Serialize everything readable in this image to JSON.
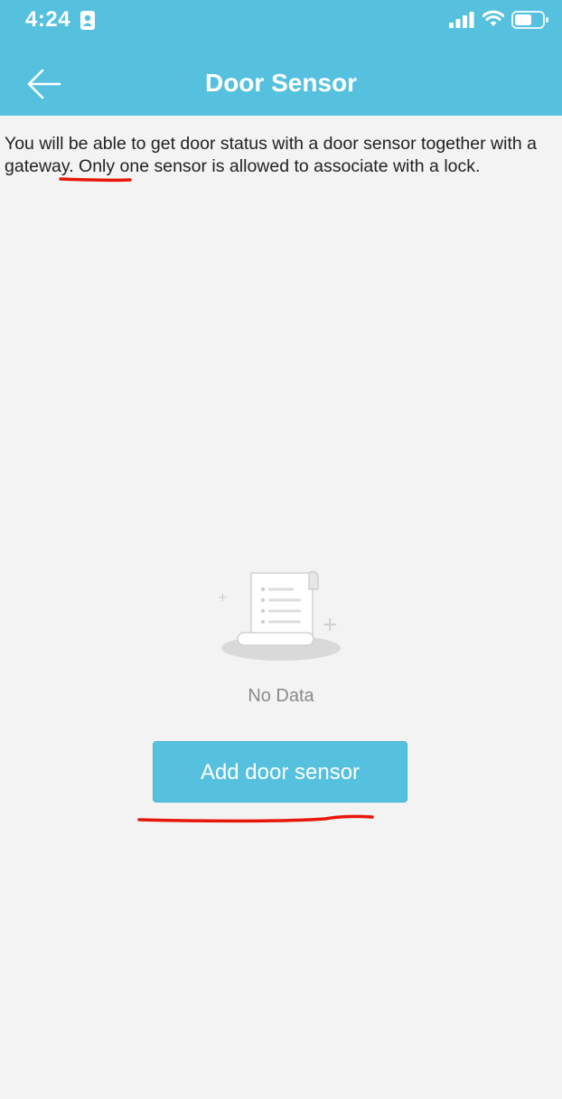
{
  "status_bar": {
    "time": "4:24"
  },
  "header": {
    "title": "Door Sensor",
    "back_icon": "arrow-left-icon"
  },
  "description": {
    "text_before": "You will be able to get door status with a door sensor together with a ",
    "link_word": "gateway",
    "text_after": ". Only one sensor is allowed to associate with a lock."
  },
  "empty_state": {
    "icon": "document-scroll-icon",
    "text": "No Data"
  },
  "actions": {
    "add_button_label": "Add door sensor"
  },
  "colors": {
    "header_bg": "#56c1df",
    "page_bg": "#f3f3f3",
    "button_bg": "#56c1df",
    "annotation_red": "#e8170b"
  }
}
